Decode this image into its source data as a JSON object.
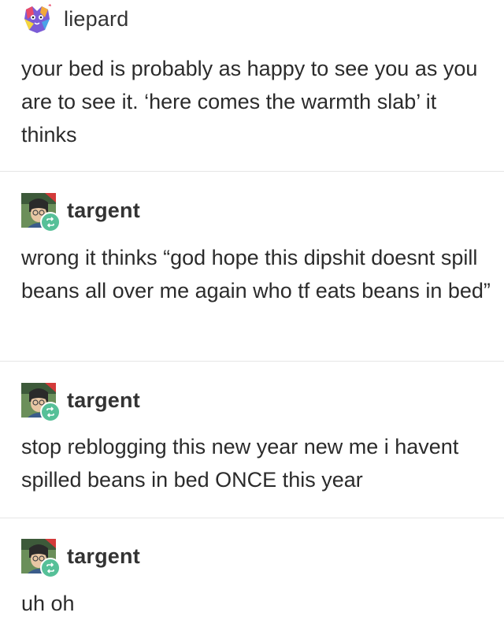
{
  "posts": [
    {
      "username": "liepard",
      "text": "your bed is probably as happy to see you as you are to see it. ‘here comes the warmth slab’ it thinks",
      "avatar_icon": "rainbow-cat-avatar-icon",
      "reblog": false
    },
    {
      "username": "targent",
      "text": "wrong it thinks “god hope this dipshit doesnt spill beans all over me again who tf eats beans in bed”",
      "avatar_icon": "cartoon-person-avatar-icon",
      "reblog": true
    },
    {
      "username": "targent",
      "text": "stop reblogging this new year new me i havent spilled beans in bed ONCE this year",
      "avatar_icon": "cartoon-person-avatar-icon",
      "reblog": true
    },
    {
      "username": "targent",
      "text": "uh oh",
      "avatar_icon": "cartoon-person-avatar-icon",
      "reblog": true
    }
  ],
  "colors": {
    "reblog_badge": "#56c098",
    "divider": "#e6e6e6",
    "text": "#2b2b2b"
  }
}
